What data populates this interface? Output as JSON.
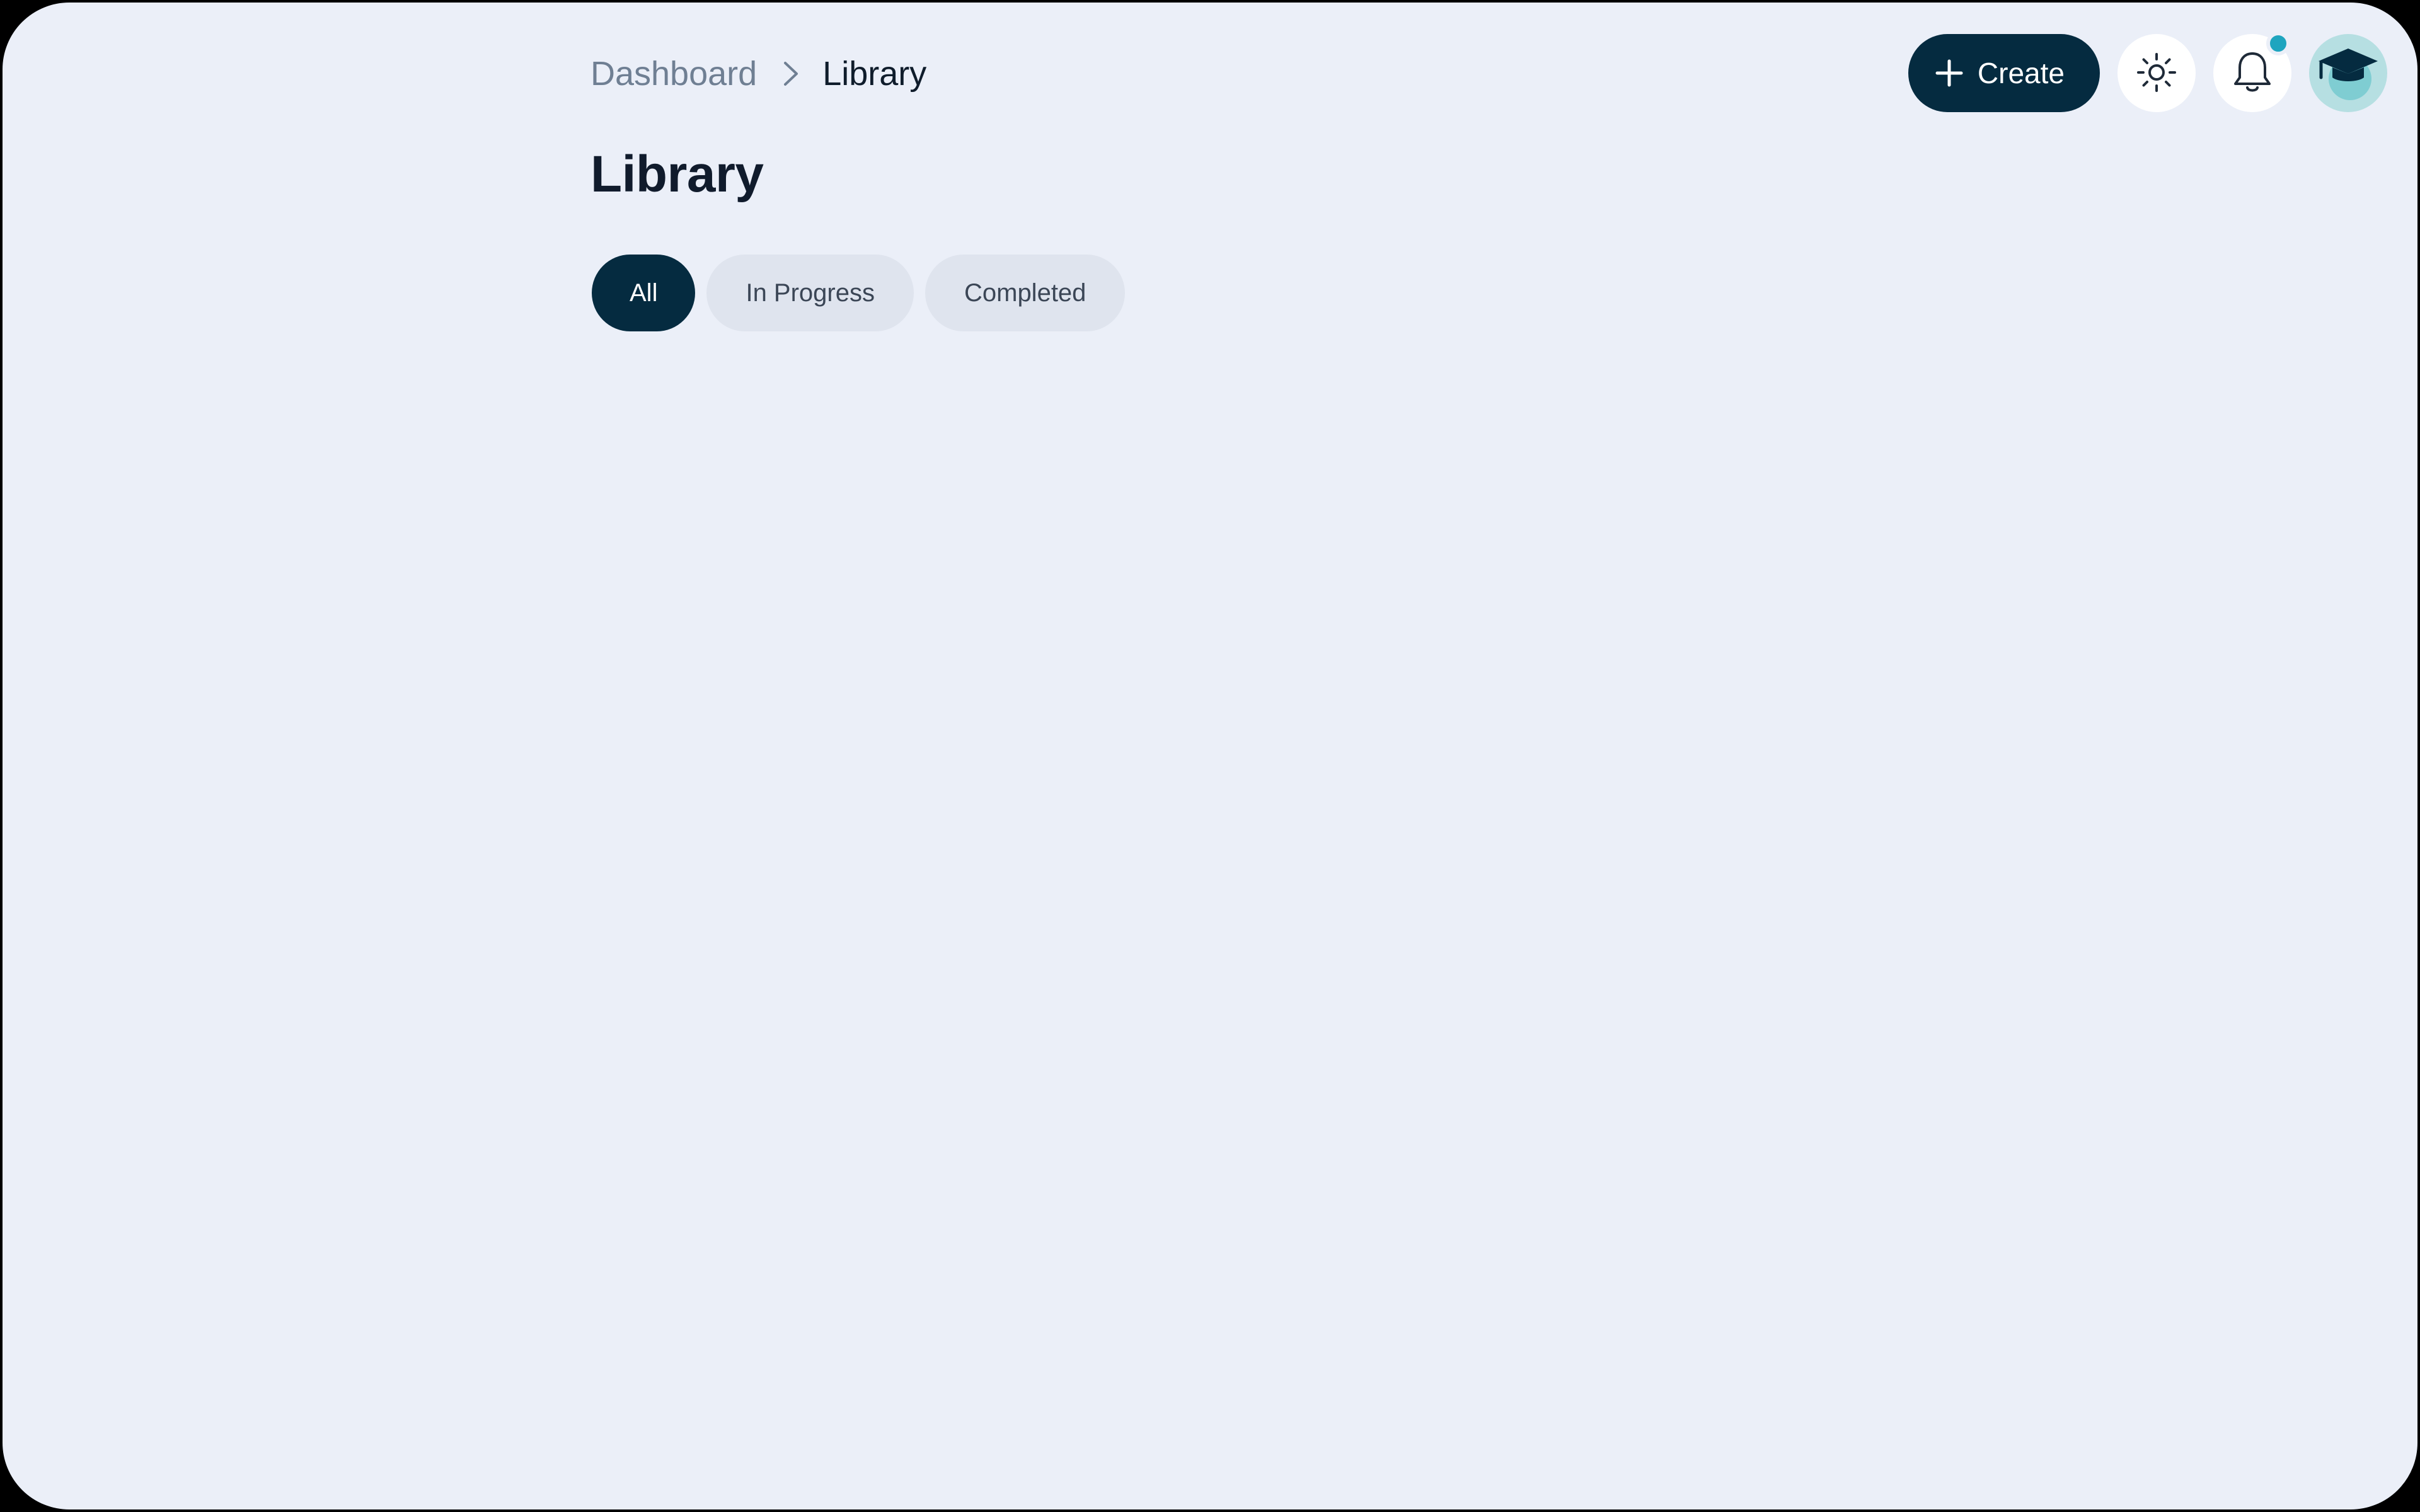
{
  "breadcrumb": {
    "parent": "Dashboard",
    "current": "Library",
    "separator_icon": "chevron-right-icon"
  },
  "page": {
    "title": "Library"
  },
  "filters": {
    "items": [
      {
        "label": "All",
        "active": true
      },
      {
        "label": "In Progress",
        "active": false
      },
      {
        "label": "Completed",
        "active": false
      }
    ]
  },
  "topbar": {
    "create_label": "Create",
    "create_icon": "plus-icon",
    "theme_icon": "sun-icon",
    "notification_icon": "bell-icon",
    "notification_badge": true,
    "avatar_icon": "graduation-cap-icon"
  },
  "colors": {
    "background": "#ebeff8",
    "primary": "#052b40",
    "chip_inactive": "#dfe4ee",
    "badge": "#1ea5bf",
    "avatar_bg": "#b6dfe2",
    "text_muted": "#6f7f93",
    "text_dark": "#101b2c"
  }
}
